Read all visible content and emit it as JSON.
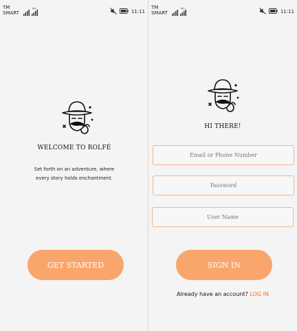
{
  "status_bar": {
    "carrier_line1": "TM",
    "carrier_line2": "SMART",
    "network": "4G",
    "time": "11:11"
  },
  "welcome": {
    "title": "WELCOME TO ROLFÉ",
    "subtitle_line1": "Set forth on an adventure, where",
    "subtitle_line2": "every story holds enchantment.",
    "button": "GET STARTED"
  },
  "signin": {
    "title": "HI THERE!",
    "email_placeholder": "Email or Phone Number",
    "password_placeholder": "Password",
    "username_placeholder": "User Name",
    "button": "SIGN IN",
    "footer_text": "Already have an account?",
    "footer_link": "LOG IN"
  },
  "colors": {
    "accent": "#f9a66c",
    "link": "#ff6b1a",
    "field_border": "#f2b78a"
  },
  "icons": [
    "mute-icon",
    "battery-icon",
    "signal-icon",
    "detective-logo-icon"
  ]
}
